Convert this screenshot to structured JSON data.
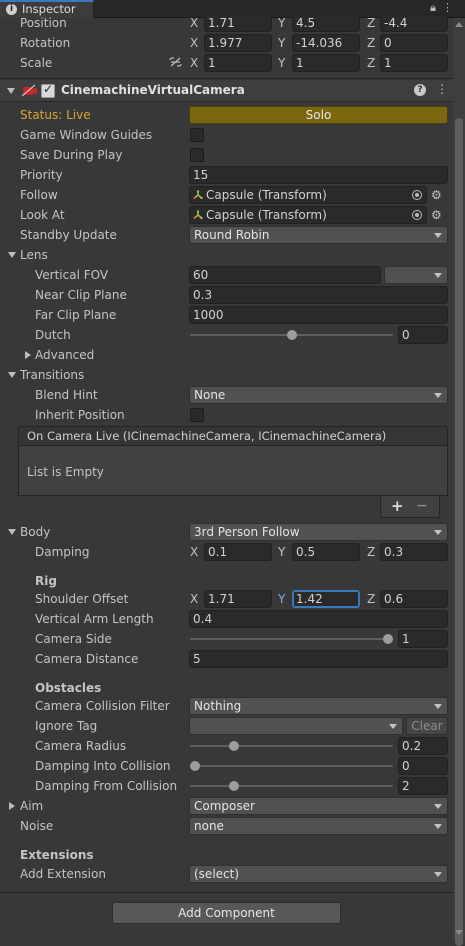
{
  "tab": {
    "title": "Inspector",
    "icon": "info-icon"
  },
  "transform": {
    "position": {
      "label": "Position",
      "x": "1.71",
      "y": "4.5",
      "z": "-4.4"
    },
    "rotation": {
      "label": "Rotation",
      "x": "1.977",
      "y": "-14.036",
      "z": "0"
    },
    "scale": {
      "label": "Scale",
      "x": "1",
      "y": "1",
      "z": "1"
    }
  },
  "axes": {
    "x": "X",
    "y": "Y",
    "z": "Z"
  },
  "component": {
    "title": "CinemachineVirtualCamera",
    "help": "?",
    "menu": "⋮"
  },
  "status": {
    "label": "Status: Live",
    "solo": "Solo"
  },
  "fields": {
    "game_window_guides": "Game Window Guides",
    "save_during_play": "Save During Play",
    "priority": {
      "label": "Priority",
      "value": "15"
    },
    "follow": {
      "label": "Follow",
      "value": "Capsule (Transform)"
    },
    "look_at": {
      "label": "Look At",
      "value": "Capsule (Transform)"
    },
    "standby": {
      "label": "Standby Update",
      "value": "Round Robin"
    }
  },
  "lens": {
    "label": "Lens",
    "vfov": {
      "label": "Vertical FOV",
      "value": "60"
    },
    "near": {
      "label": "Near Clip Plane",
      "value": "0.3"
    },
    "far": {
      "label": "Far Clip Plane",
      "value": "1000"
    },
    "dutch": {
      "label": "Dutch",
      "value": "0",
      "slider_fraction": 0.5
    },
    "advanced": "Advanced"
  },
  "transitions": {
    "label": "Transitions",
    "blend_hint": {
      "label": "Blend Hint",
      "value": "None"
    },
    "inherit": "Inherit Position",
    "event_header": "On Camera Live (ICinemachineCamera, ICinemachineCamera)",
    "empty": "List is Empty",
    "add": "+",
    "remove": "−"
  },
  "body": {
    "label": "Body",
    "value": "3rd Person Follow",
    "damping": {
      "label": "Damping",
      "x": "0.1",
      "y": "0.5",
      "z": "0.3"
    },
    "rig": "Rig",
    "shoulder": {
      "label": "Shoulder Offset",
      "x": "1.71",
      "y": "1.42",
      "z": "0.6"
    },
    "arm": {
      "label": "Vertical Arm Length",
      "value": "0.4"
    },
    "side": {
      "label": "Camera Side",
      "value": "1",
      "slider_fraction": 1.0
    },
    "distance": {
      "label": "Camera Distance",
      "value": "5"
    },
    "obstacles": "Obstacles",
    "filter": {
      "label": "Camera Collision Filter",
      "value": "Nothing"
    },
    "ignore": {
      "label": "Ignore Tag",
      "value": "",
      "clear": "Clear"
    },
    "radius": {
      "label": "Camera Radius",
      "value": "0.2",
      "slider_fraction": 0.2
    },
    "into": {
      "label": "Damping Into Collision",
      "value": "0",
      "slider_fraction": 0.0
    },
    "from": {
      "label": "Damping From Collision",
      "value": "2",
      "slider_fraction": 0.2
    }
  },
  "aim": {
    "label": "Aim",
    "value": "Composer"
  },
  "noise": {
    "label": "Noise",
    "value": "none"
  },
  "extensions": {
    "label": "Extensions",
    "add": {
      "label": "Add Extension",
      "value": "(select)"
    }
  },
  "add_component": "Add Component",
  "colors": {
    "accent": "#3a79bb",
    "solo": "#7a6710"
  }
}
